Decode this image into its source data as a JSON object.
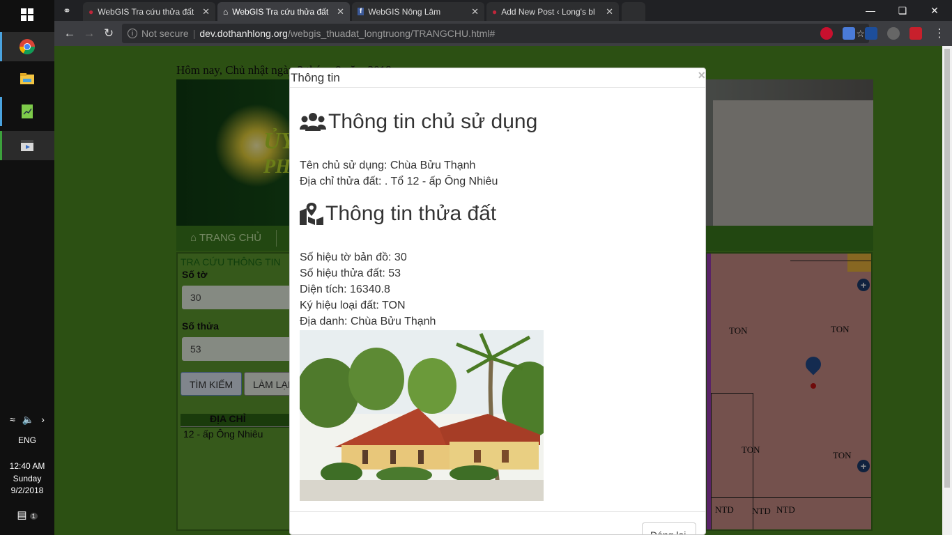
{
  "taskbar": {
    "tray": {
      "language": "ENG",
      "time": "12:40 AM",
      "day": "Sunday",
      "date": "9/2/2018",
      "notification_count": "1"
    }
  },
  "tabs": [
    {
      "title": "WebGIS Tra cứu thửa đất",
      "active": false
    },
    {
      "title": "WebGIS Tra cứu thửa đất",
      "active": true
    },
    {
      "title": "WebGIS Nông Lâm",
      "active": false
    },
    {
      "title": "Add New Post ‹ Long's bl",
      "active": false
    }
  ],
  "address_bar": {
    "security": "Not secure",
    "host": "dev.dothanhlong.org",
    "path": "/webgis_thuadat_longtruong/TRANGCHU.html#"
  },
  "page": {
    "date_line": "Hôm nay, Chủ nhật ngày 2 tháng 9 năm 2018",
    "nav_home": "TRANG CHỦ",
    "search_panel": {
      "title": "TRA CỨU THÔNG TIN",
      "sheet_label": "Số tờ",
      "sheet_value": "30",
      "parcel_label": "Số thửa",
      "parcel_value": "53",
      "search_button": "TÌM KIẾM",
      "reset_button": "LÀM LẠI",
      "address_col": "ĐỊA CHỈ",
      "address_row": "12 - ấp Ông Nhiêu"
    },
    "map_labels": [
      "TON",
      "TON",
      "TON",
      "TON",
      "NTD",
      "NTD",
      "NTD"
    ]
  },
  "modal": {
    "title": "Thông tin",
    "owner_heading": "Thông tin chủ sử dụng",
    "owner_name": "Tên chủ sử dụng: Chùa Bửu Thạnh",
    "owner_address": "Địa chỉ thửa đất: . Tổ 12 - ấp Ông Nhiêu",
    "parcel_heading": "Thông tin thửa đất",
    "sheet_no": "Số hiệu tờ bản đồ: 30",
    "parcel_no": "Số hiệu thửa đất: 53",
    "area": "Diện tích: 16340.8",
    "land_type": "Ký hiệu loại đất: TON",
    "place_name": "Địa danh: Chùa Bửu Thạnh",
    "close_button": "Đóng lại"
  }
}
